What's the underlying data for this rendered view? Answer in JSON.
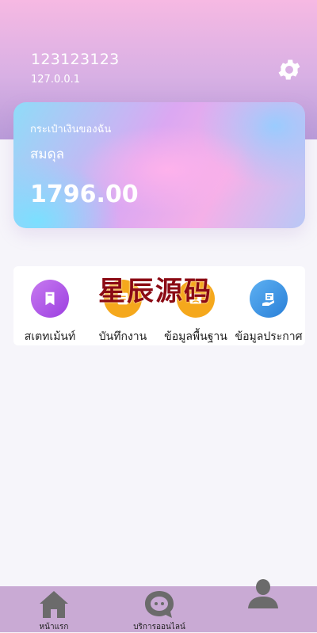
{
  "header": {
    "username": "123123123",
    "ip": "127.0.0.1"
  },
  "wallet_card": {
    "title": "กระเป๋าเงินของฉัน",
    "subtitle": "สมดุล",
    "balance": "1796.00"
  },
  "menu": {
    "items": [
      {
        "label": "สเตทเม้นท์",
        "icon": "bookmark-icon",
        "color": "#b054e6"
      },
      {
        "label": "บันทึกงาน",
        "icon": "notebook-icon",
        "color": "#f5a81c"
      },
      {
        "label": "ข้อมูลพื้นฐาน",
        "icon": "profile-card-icon",
        "color": "#f5a81c"
      },
      {
        "label": "ข้อมูลประกาศ",
        "icon": "announcement-icon",
        "color": "#2f8ee0"
      }
    ]
  },
  "watermark": "星辰源码",
  "bottom_nav": {
    "items": [
      {
        "label": "หน้าแรก",
        "icon": "home-icon"
      },
      {
        "label": "บริการออนไลน์",
        "icon": "chat-bubble-icon"
      },
      {
        "label": "",
        "icon": "user-icon"
      }
    ]
  }
}
